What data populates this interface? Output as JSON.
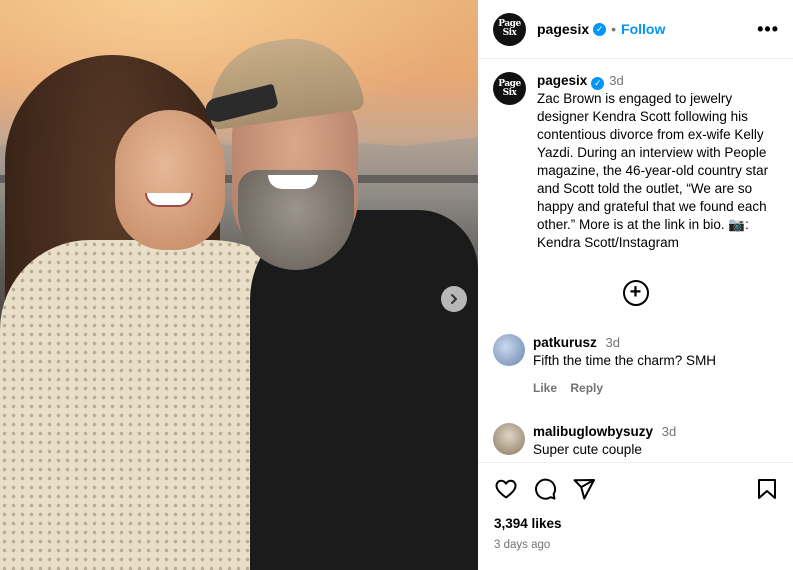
{
  "post": {
    "account": "pagesix",
    "logo_line1": "Page",
    "logo_line2": "Six",
    "follow_label": "Follow",
    "more_label": "•••",
    "separator": "•"
  },
  "caption": {
    "user": "pagesix",
    "time": "3d",
    "text": "Zac Brown is engaged to jewelry designer Kendra Scott following his contentious divorce from ex-wife Kelly Yazdi. During an interview with People magazine, the 46-year-old country star and Scott told the outlet, “We are so happy and grateful that we found each other.” More is at the link in bio. 📷: Kendra Scott/Instagram"
  },
  "load_more_symbol": "+",
  "comments": [
    {
      "user": "patkurusz",
      "time": "3d",
      "text": "Fifth the time the charm? SMH",
      "like_label": "Like",
      "reply_label": "Reply"
    },
    {
      "user": "malibuglowbysuzy",
      "time": "3d",
      "text": "Super cute couple"
    }
  ],
  "footer": {
    "likes": "3,394 likes",
    "ago": "3 days ago"
  },
  "icons": {
    "verified": "verified-badge-icon",
    "next": "chevron-right-icon",
    "like": "heart-icon",
    "comment": "comment-icon",
    "share": "send-icon",
    "save": "bookmark-icon",
    "load_more": "plus-circle-icon"
  },
  "colors": {
    "accent": "#0095f6",
    "muted": "#737373"
  }
}
